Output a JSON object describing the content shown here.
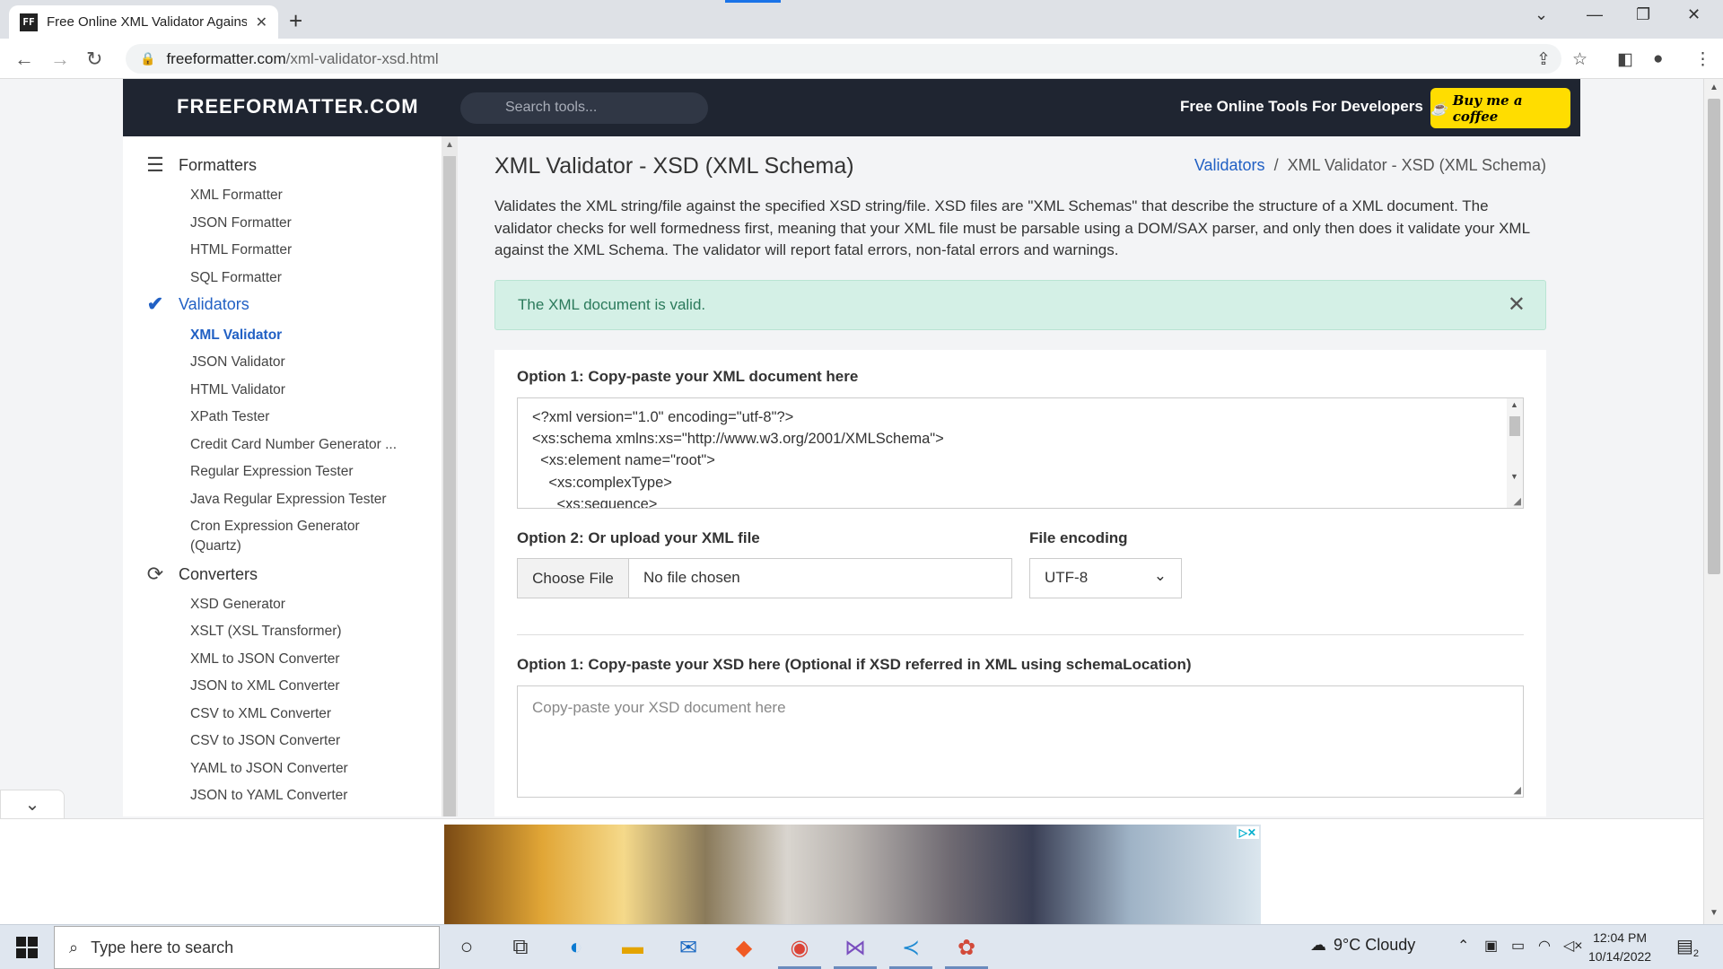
{
  "browser": {
    "tab_title": "Free Online XML Validator Against",
    "tab_favicon": "FF",
    "url_host": "freeformatter.com",
    "url_path": "/xml-validator-xsd.html"
  },
  "header": {
    "logo": "FREEFORMATTER.COM",
    "search_placeholder": "Search tools...",
    "tagline": "Free Online Tools For Developers",
    "coffee_label": "Buy me a coffee"
  },
  "sidebar": {
    "sections": [
      {
        "label": "Formatters",
        "icon": "list-indent-icon",
        "items": [
          "XML Formatter",
          "JSON Formatter",
          "HTML Formatter",
          "SQL Formatter"
        ]
      },
      {
        "label": "Validators",
        "icon": "double-check-icon",
        "items": [
          "XML Validator",
          "JSON Validator",
          "HTML Validator",
          "XPath Tester",
          "Credit Card Number Generator ...",
          "Regular Expression Tester",
          "Java Regular Expression Tester",
          "Cron Expression Generator (Quartz)"
        ]
      },
      {
        "label": "Converters",
        "icon": "refresh-icon",
        "items": [
          "XSD Generator",
          "XSLT (XSL Transformer)",
          "XML to JSON Converter",
          "JSON to XML Converter",
          "CSV to XML Converter",
          "CSV to JSON Converter",
          "YAML to JSON Converter",
          "JSON to YAML Converter"
        ]
      }
    ]
  },
  "main": {
    "title": "XML Validator - XSD (XML Schema)",
    "breadcrumb": {
      "link": "Validators",
      "separator": "/",
      "current": "XML Validator - XSD (XML Schema)"
    },
    "description": "Validates the XML string/file against the specified XSD string/file. XSD files are \"XML Schemas\" that describe the structure of a XML document. The validator checks for well formedness first, meaning that your XML file must be parsable using a DOM/SAX parser, and only then does it validate your XML against the XML Schema. The validator will report fatal errors, non-fatal errors and warnings.",
    "alert": "The XML document is valid.",
    "option1_label": "Option 1: Copy-paste your XML document here",
    "xml_lines": [
      "<?xml version=\"1.0\" encoding=\"utf-8\"?>",
      "<xs:schema xmlns:xs=\"http://www.w3.org/2001/XMLSchema\">",
      "  <xs:element name=\"root\">",
      "    <xs:complexType>",
      "      <xs:sequence>"
    ],
    "option2_label": "Option 2: Or upload your XML file",
    "choose_file": "Choose File",
    "no_file": "No file chosen",
    "encoding_label": "File encoding",
    "encoding_value": "UTF-8",
    "xsd_label": "Option 1: Copy-paste your XSD here (Optional if XSD referred in XML using schemaLocation)",
    "xsd_placeholder": "Copy-paste your XSD document here"
  },
  "taskbar": {
    "search_placeholder": "Type here to search",
    "weather": "9°C  Cloudy",
    "time": "12:04 PM",
    "date": "10/14/2022",
    "notification_count": "2"
  }
}
